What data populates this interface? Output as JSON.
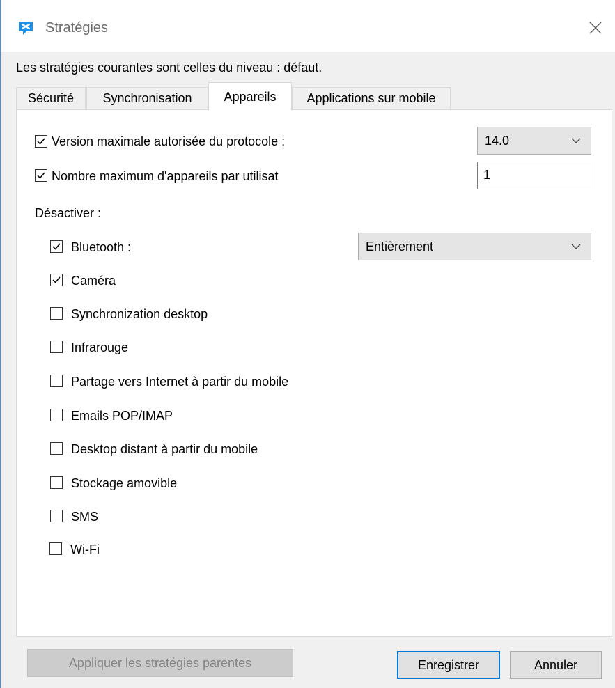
{
  "window": {
    "title": "Stratégies",
    "icon": "chat-bubble-icon",
    "accent_color": "#0078d7"
  },
  "info_text": "Les stratégies courantes sont celles du niveau : défaut.",
  "tabs": [
    {
      "label": "Sécurité",
      "active": false
    },
    {
      "label": "Synchronisation",
      "active": false
    },
    {
      "label": "Appareils",
      "active": true
    },
    {
      "label": "Applications sur mobile",
      "active": false
    }
  ],
  "protocol": {
    "label": "Version maximale autorisée du protocole :",
    "checked": true,
    "value": "14.0"
  },
  "max_devices": {
    "label": "Nombre maximum d'appareils par utilisat",
    "checked": true,
    "value": "1"
  },
  "disable_heading": "Désactiver :",
  "bluetooth": {
    "label": "Bluetooth :",
    "checked": true,
    "value": "Entièrement"
  },
  "options": [
    {
      "label": "Caméra",
      "checked": true
    },
    {
      "label": "Synchronization desktop",
      "checked": false
    },
    {
      "label": "Infrarouge",
      "checked": false
    },
    {
      "label": "Partage vers Internet à partir du mobile",
      "checked": false
    },
    {
      "label": "Emails POP/IMAP",
      "checked": false
    },
    {
      "label": "Desktop distant à partir du mobile",
      "checked": false
    },
    {
      "label": "Stockage amovible",
      "checked": false
    },
    {
      "label": "SMS",
      "checked": false
    },
    {
      "label": "Wi-Fi",
      "checked": false
    }
  ],
  "buttons": {
    "apply_parent": "Appliquer les stratégies parentes",
    "save": "Enregistrer",
    "cancel": "Annuler"
  }
}
